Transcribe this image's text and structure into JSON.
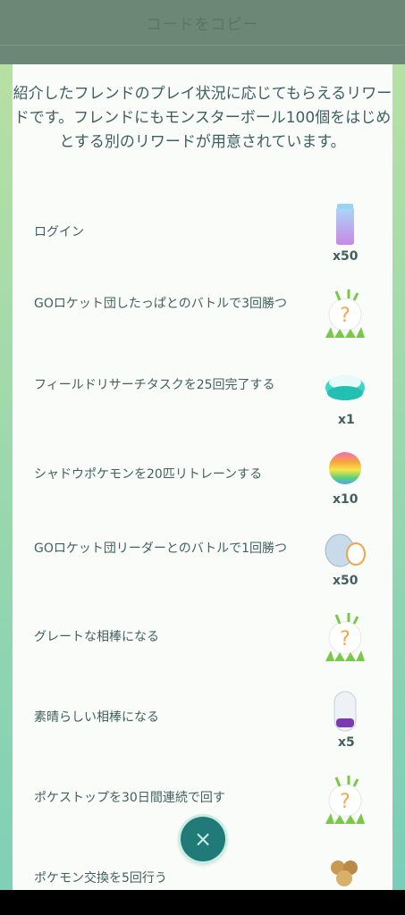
{
  "header": {
    "copy_label": "コードをコピー"
  },
  "intro_text": "紹介したフレンドのプレイ状況に応じてもらえるリワードです。フレンドにもモンスターボール100個をはじめとする別のリワードが用意されています。",
  "rewards": [
    {
      "task": "ログイン",
      "icon": "incense-icon",
      "qty": "x50"
    },
    {
      "task": "GOロケット団したっぱとのバトルで3回勝つ",
      "icon": "mystery-reward-icon",
      "qty": ""
    },
    {
      "task": "フィールドリサーチタスクを25回完了する",
      "icon": "lure-module-icon",
      "qty": "x1"
    },
    {
      "task": "シャドウポケモンを20匹リトレーンする",
      "icon": "rare-candy-icon",
      "qty": "x10"
    },
    {
      "task": "GOロケット団リーダーとのバトルで1回勝つ",
      "icon": "fast-tm-icon",
      "qty": "x50"
    },
    {
      "task": "グレートな相棒になる",
      "icon": "mystery-reward-icon",
      "qty": ""
    },
    {
      "task": "素晴らしい相棒になる",
      "icon": "incubator-icon",
      "qty": "x5"
    },
    {
      "task": "ポケストップを30日間連続で回す",
      "icon": "mystery-reward-icon",
      "qty": ""
    },
    {
      "task": "ポケモン交換を5回行う",
      "icon": "pokemon-group-icon",
      "qty": ""
    }
  ],
  "close_label": "×"
}
